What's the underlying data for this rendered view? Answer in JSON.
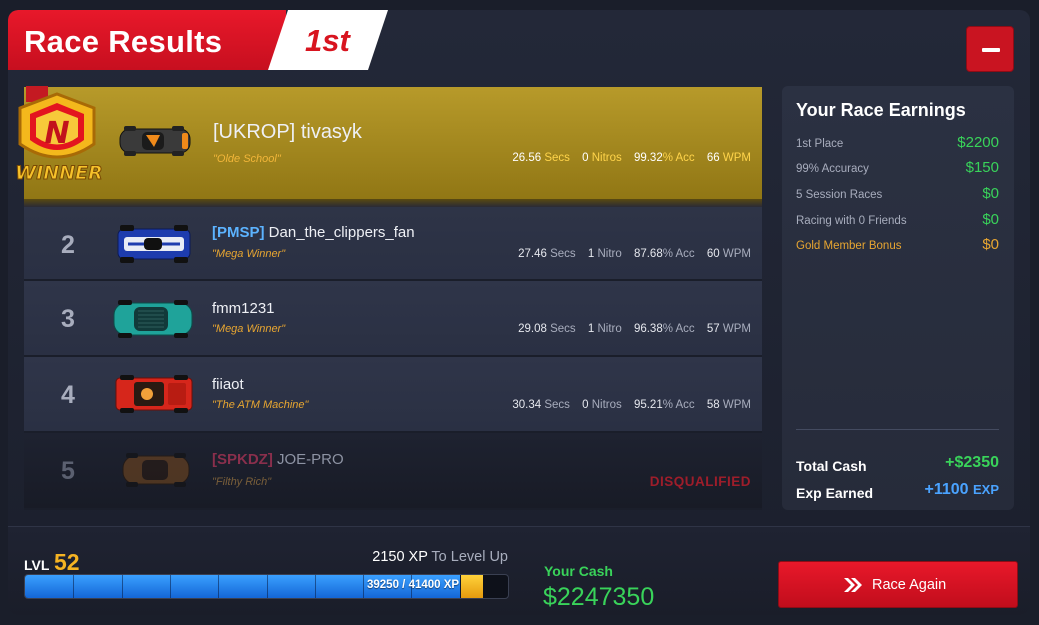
{
  "header": {
    "title": "Race Results",
    "place": "1st"
  },
  "badge": {
    "text": "WINNER",
    "letter": "N"
  },
  "racers": [
    {
      "rank": "",
      "tag": "[UKROP]",
      "name": "tivasyk",
      "title": "\"Olde School\"",
      "secs": "26.56",
      "secs_unit": "Secs",
      "nitros": "0",
      "nitros_unit": "Nitros",
      "acc": "99.32",
      "acc_unit": "% Acc",
      "wpm": "66",
      "wpm_unit": "WPM",
      "car_color": "#3a3a3a"
    },
    {
      "rank": "2",
      "tag": "[PMSP]",
      "name": "Dan_the_clippers_fan",
      "title": "\"Mega Winner\"",
      "secs": "27.46",
      "secs_unit": "Secs",
      "nitros": "1",
      "nitros_unit": "Nitro",
      "acc": "87.68",
      "acc_unit": "% Acc",
      "wpm": "60",
      "wpm_unit": "WPM",
      "car_color": "#1d3cae"
    },
    {
      "rank": "3",
      "tag": "",
      "name": "fmm1231",
      "title": "\"Mega Winner\"",
      "secs": "29.08",
      "secs_unit": "Secs",
      "nitros": "1",
      "nitros_unit": "Nitro",
      "acc": "96.38",
      "acc_unit": "% Acc",
      "wpm": "57",
      "wpm_unit": "WPM",
      "car_color": "#1fa39a"
    },
    {
      "rank": "4",
      "tag": "",
      "name": "fiiaot",
      "title": "\"The ATM Machine\"",
      "secs": "30.34",
      "secs_unit": "Secs",
      "nitros": "0",
      "nitros_unit": "Nitros",
      "acc": "95.21",
      "acc_unit": "% Acc",
      "wpm": "58",
      "wpm_unit": "WPM",
      "car_color": "#d6261b"
    },
    {
      "rank": "5",
      "tag": "[SPKDZ]",
      "name": "JOE-PRO",
      "title": "\"Filthy Rich\"",
      "status": "DISQUALIFIED",
      "car_color": "#7a4a1e"
    }
  ],
  "earnings": {
    "title": "Your Race Earnings",
    "items": [
      {
        "label": "1st Place",
        "amount": "$2200"
      },
      {
        "label": "99% Accuracy",
        "amount": "$150"
      },
      {
        "label": "5 Session Races",
        "amount": "$0"
      },
      {
        "label": "Racing with 0 Friends",
        "amount": "$0"
      },
      {
        "label": "Gold Member Bonus",
        "amount": "$0"
      }
    ],
    "total_cash_label": "Total Cash",
    "total_cash": "+$2350",
    "exp_label": "Exp Earned",
    "exp_value": "+1100",
    "exp_unit": "EXP"
  },
  "footer": {
    "lvl_label": "LVL",
    "lvl": "52",
    "xp_to_level": "2150 XP",
    "xp_to_level_suffix": "To Level Up",
    "xp_progress_text": "39250 / 41400 XP",
    "xp_fraction": 0.948,
    "cash_label": "Your Cash",
    "cash_value": "$2247350",
    "race_again": "Race Again"
  },
  "colors": {
    "accent_red": "#e8182a",
    "winner_gold": "#b79a2a",
    "money_green": "#39d35a",
    "exp_blue": "#4aa3ff",
    "title_orange": "#e8a631"
  }
}
